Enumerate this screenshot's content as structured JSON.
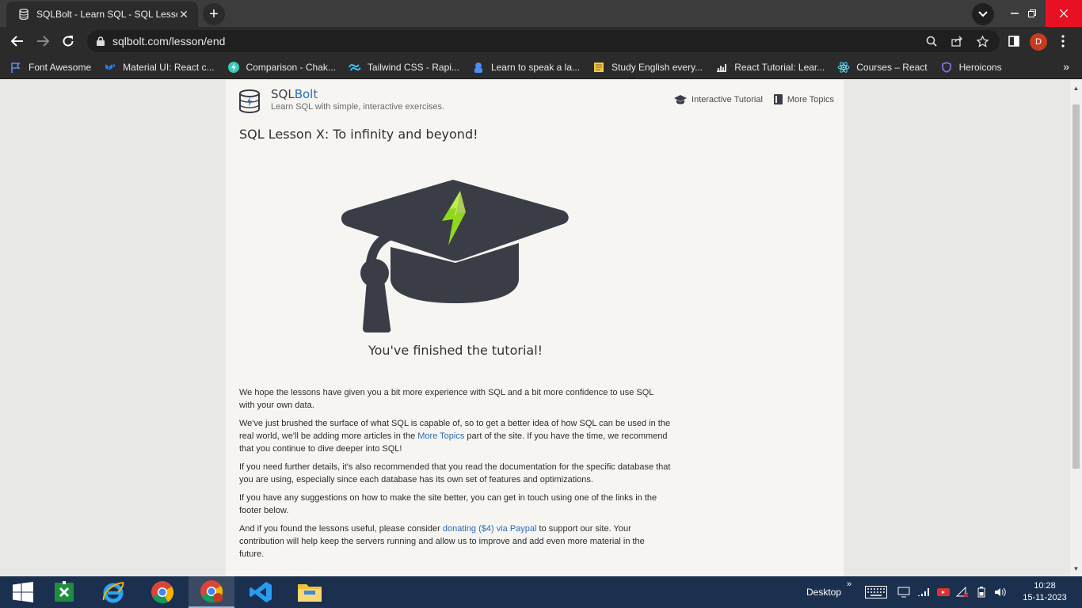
{
  "browser": {
    "tab_title": "SQLBolt - Learn SQL - SQL Lesson",
    "close_glyph": "✕",
    "new_tab_glyph": "+",
    "url": "sqlbolt.com/lesson/end",
    "profile_initial": "D"
  },
  "bookmarks": [
    {
      "label": "Font Awesome",
      "icon": "flag-icon",
      "color": "#5a8dee"
    },
    {
      "label": "Material UI: React c...",
      "icon": "mui-icon",
      "color": "#2b7de9"
    },
    {
      "label": "Comparison - Chak...",
      "icon": "chakra-icon",
      "color": "#3cc9b7"
    },
    {
      "label": "Tailwind CSS - Rapi...",
      "icon": "tailwind-icon",
      "color": "#38bdf8"
    },
    {
      "label": "Learn to speak a la...",
      "icon": "duolingo-icon",
      "color": "#4b8cf5"
    },
    {
      "label": "Study English every...",
      "icon": "notebook-icon",
      "color": "#f1c84b"
    },
    {
      "label": "React Tutorial: Lear...",
      "icon": "chart-icon",
      "color": "#e0e0e0"
    },
    {
      "label": "Courses – React",
      "icon": "react-icon",
      "color": "#61dafb"
    },
    {
      "label": "Heroicons",
      "icon": "shield-icon",
      "color": "#8b7cf6"
    }
  ],
  "site": {
    "brand_prefix": "SQL",
    "brand_suffix": "Bolt",
    "tagline": "Learn SQL with simple, interactive exercises.",
    "nav_tutorial": "Interactive Tutorial",
    "nav_topics": "More Topics",
    "lesson_title": "SQL Lesson X: To infinity and beyond!",
    "finished": "You've finished the tutorial!",
    "p1": "We hope the lessons have given you a bit more experience with SQL and a bit more confidence to use SQL with your own data.",
    "p2_a": "We've just brushed the surface of what SQL is capable of, so to get a better idea of how SQL can be used in the real world, we'll be adding more articles in the ",
    "p2_link": "More Topics",
    "p2_b": " part of the site. If you have the time, we recommend that you continue to dive deeper into SQL!",
    "p3": "If you need further details, it's also recommended that you read the documentation for the specific database that you are using, especially since each database has its own set of features and optimizations.",
    "p4": "If you have any suggestions on how to make the site better, you can get in touch using one of the links in the footer below.",
    "p5_a": "And if you found the lessons useful, please consider ",
    "p5_link": "donating ($4) via Paypal",
    "p5_b": " to support our site. Your contribution will help keep the servers running and allow us to improve and add even more material in the future."
  },
  "taskbar": {
    "desktop_label": "Desktop",
    "time": "10:28",
    "date": "15-11-2023"
  },
  "colors": {
    "accent": "#2b6db3",
    "cap_dark": "#3a3d45",
    "bolt_green": "#8fd81f"
  }
}
